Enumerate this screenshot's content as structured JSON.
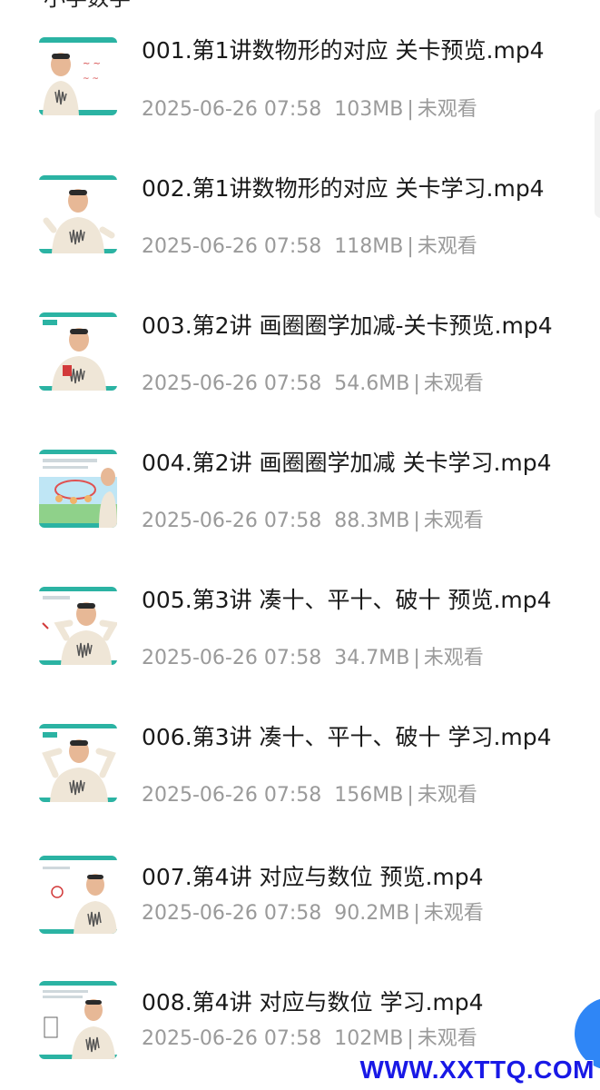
{
  "header": {
    "title_fragment": "小学数学"
  },
  "files": [
    {
      "name": "001.第1讲数物形的对应 关卡预览.mp4",
      "date": "2025-06-26 07:58",
      "size": "103MB",
      "status": "未观看",
      "thumb": "teacher-board-icon"
    },
    {
      "name": "002.第1讲数物形的对应 关卡学习.mp4",
      "date": "2025-06-26 07:58",
      "size": "118MB",
      "status": "未观看",
      "thumb": "teacher-center-icon"
    },
    {
      "name": "003.第2讲 画圈圈学加减-关卡预览.mp4",
      "date": "2025-06-26 07:58",
      "size": "54.6MB",
      "status": "未观看",
      "thumb": "teacher-center-icon"
    },
    {
      "name": "004.第2讲 画圈圈学加减 关卡学习.mp4",
      "date": "2025-06-26 07:58",
      "size": "88.3MB",
      "status": "未观看",
      "thumb": "cartoon-slide-icon"
    },
    {
      "name": "005.第3讲 凑十、平十、破十 预览.mp4",
      "date": "2025-06-26 07:58",
      "size": "34.7MB",
      "status": "未观看",
      "thumb": "teacher-arms-icon"
    },
    {
      "name": "006.第3讲 凑十、平十、破十 学习.mp4",
      "date": "2025-06-26 07:58",
      "size": "156MB",
      "status": "未观看",
      "thumb": "teacher-arms-icon"
    },
    {
      "name": "007.第4讲 对应与数位 预览.mp4",
      "date": "2025-06-26 07:58",
      "size": "90.2MB",
      "status": "未观看",
      "thumb": "teacher-right-icon"
    },
    {
      "name": "008.第4讲 对应与数位 学习.mp4",
      "date": "2025-06-26 07:58",
      "size": "102MB",
      "status": "未观看",
      "thumb": "teacher-right-icon"
    }
  ],
  "separator": "|",
  "watermark": "WWW.XXTTQ.COM",
  "colors": {
    "accent": "#2f86f6",
    "thumb_bar": "#2bb3a3",
    "meta": "#9a9a9a",
    "watermark": "#1919e6"
  }
}
